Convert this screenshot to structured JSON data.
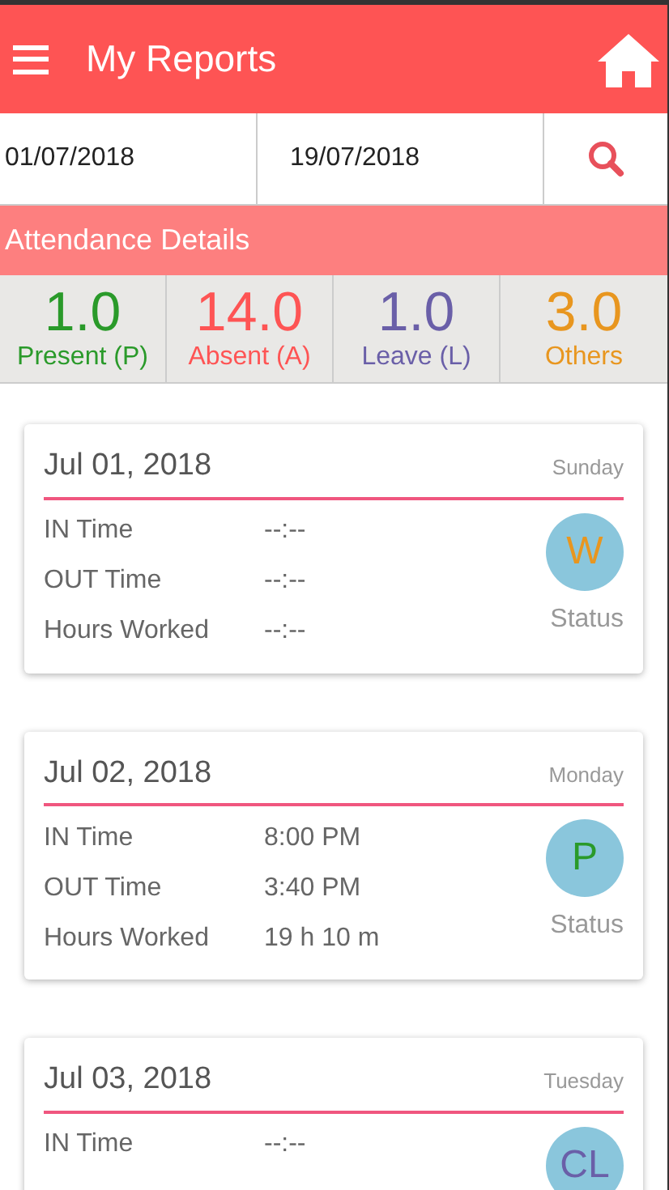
{
  "header": {
    "title": "My Reports"
  },
  "date_range": {
    "from": "01/07/2018",
    "to": "19/07/2018"
  },
  "section_title": "Attendance Details",
  "summary": [
    {
      "value": "1.0",
      "label": "Present (P)",
      "color": "#2a9a2a"
    },
    {
      "value": "14.0",
      "label": "Absent (A)",
      "color": "#fe5454"
    },
    {
      "value": "1.0",
      "label": "Leave (L)",
      "color": "#6a5fa8"
    },
    {
      "value": "3.0",
      "label": "Others",
      "color": "#e8961f"
    }
  ],
  "days": [
    {
      "date": "Jul 01, 2018",
      "weekday": "Sunday",
      "rows": [
        {
          "label": "IN Time",
          "value": "--:--"
        },
        {
          "label": "OUT Time",
          "value": "--:--"
        },
        {
          "label": "Hours Worked",
          "value": "--:--"
        }
      ],
      "status": "W",
      "color": "#e8961f",
      "status_label": "Status"
    },
    {
      "date": "Jul 02, 2018",
      "weekday": "Monday",
      "rows": [
        {
          "label": "IN Time",
          "value": "8:00 PM"
        },
        {
          "label": "OUT Time",
          "value": "3:40 PM"
        },
        {
          "label": "Hours Worked",
          "value": "19 h 10 m"
        }
      ],
      "status": "P",
      "color": "#2a9a2a",
      "status_label": "Status"
    },
    {
      "date": "Jul 03, 2018",
      "weekday": "Tuesday",
      "rows": [
        {
          "label": "IN Time",
          "value": "--:--"
        }
      ],
      "status": "CL",
      "color": "#6a5fa8"
    }
  ]
}
